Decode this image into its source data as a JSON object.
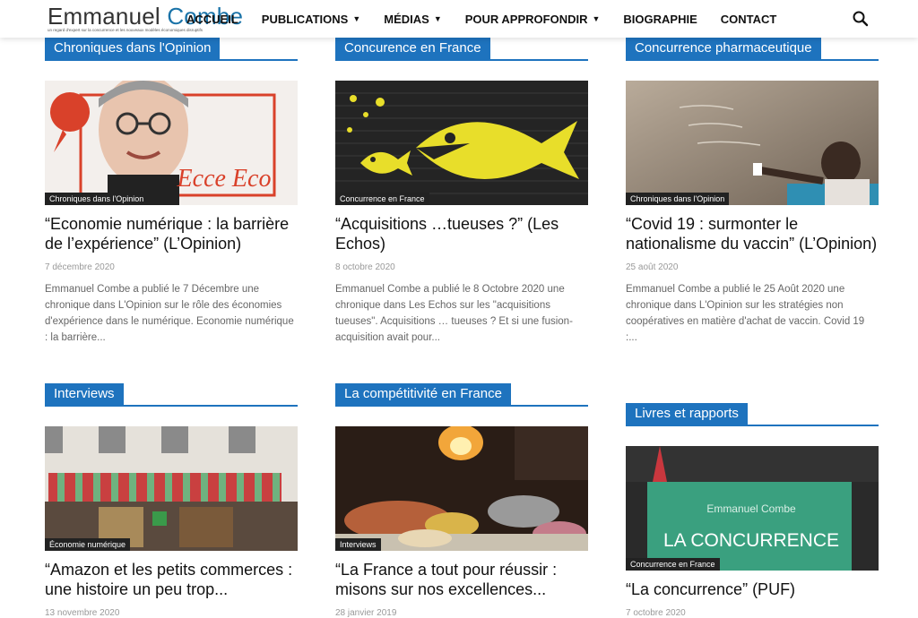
{
  "header": {
    "logo_name_main": "Emmanuel ",
    "logo_name_accent": "Combe",
    "logo_tagline": "un regard d'expert sur la concurrence et les nouveaux modèles économiques disruptifs",
    "nav": [
      {
        "label": "ACCUEIL",
        "has_dropdown": false
      },
      {
        "label": "PUBLICATIONS",
        "has_dropdown": true
      },
      {
        "label": "MÉDIAS",
        "has_dropdown": true
      },
      {
        "label": "POUR APPROFONDIR",
        "has_dropdown": true
      },
      {
        "label": "BIOGRAPHIE",
        "has_dropdown": false
      },
      {
        "label": "CONTACT",
        "has_dropdown": false
      }
    ],
    "search_icon": "search-icon",
    "accent_color": "#1e73be"
  },
  "sections": [
    {
      "heading": "Chroniques dans l'Opinion",
      "category": "Chroniques dans l'Opinion",
      "title": "“Economie numérique : la barrière de l’expérience” (L’Opinion)",
      "date": "7 décembre 2020",
      "excerpt": "Emmanuel Combe a publié le 7 Décembre une chronique dans L'Opinion sur le rôle des économies d'expérience dans le numérique.   Economie numérique : la barrière...",
      "image_text": "Ecce Eco"
    },
    {
      "heading": "Concurence en France",
      "category": "Concurrence en France",
      "title": "“Acquisitions …tueuses ?” (Les Echos)",
      "date": "8 octobre 2020",
      "excerpt": "Emmanuel Combe a publié le 8 Octobre 2020 une chronique dans Les Echos sur les \"acquisitions tueuses\". Acquisitions … tueuses ?   Et si une fusion-acquisition avait pour..."
    },
    {
      "heading": "Concurrence pharmaceutique",
      "category": "Chroniques dans l'Opinion",
      "title": "“Covid 19 : surmonter le nationalisme du vaccin” (L’Opinion)",
      "date": "25 août 2020",
      "excerpt": "Emmanuel Combe a publié le 25 Août 2020 une chronique dans L'Opinion sur les stratégies non coopératives en matière d'achat de vaccin.   Covid 19 :..."
    },
    {
      "heading": "Interviews",
      "category": "Économie numérique",
      "title": "“Amazon et les petits commerces : une histoire un peu trop...",
      "date": "13 novembre 2020"
    },
    {
      "heading": "La compétitivité en France",
      "category": "Interviews",
      "title": "“La France a tout pour réussir : misons sur nos excellences...",
      "date": "28 janvier 2019"
    },
    {
      "heading": "Livres et rapports",
      "category": "Concurrence en France",
      "title": "“La concurrence” (PUF)",
      "date": "7 octobre 2020",
      "book_author": "Emmanuel Combe",
      "book_title": "LA CONCURRENCE"
    }
  ]
}
